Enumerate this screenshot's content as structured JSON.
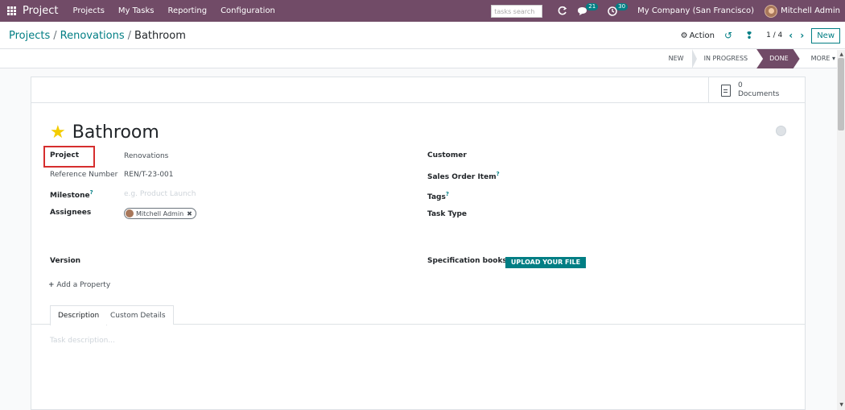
{
  "navbar": {
    "brand": "Project",
    "menu": [
      "Projects",
      "My Tasks",
      "Reporting",
      "Configuration"
    ],
    "search_placeholder": "tasks search",
    "messages_count": "21",
    "activities_count": "30",
    "company": "My Company (San Francisco)",
    "user": "Mitchell Admin"
  },
  "breadcrumb": {
    "items": [
      "Projects",
      "Renovations",
      "Bathroom"
    ],
    "separator": "/"
  },
  "control_panel": {
    "action_label": "Action",
    "pager": "1 / 4",
    "new_label": "New"
  },
  "stages": [
    "NEW",
    "IN PROGRESS",
    "DONE",
    "MORE"
  ],
  "current_stage": "DONE",
  "documents": {
    "count": "0",
    "label": "Documents"
  },
  "task": {
    "title": "Bathroom",
    "starred": true
  },
  "fields": {
    "project_label": "Project",
    "project_value": "Renovations",
    "reference_label": "Reference Number",
    "reference_value": "REN/T-23-001",
    "milestone_label": "Milestone",
    "milestone_placeholder": "e.g. Product Launch",
    "assignees_label": "Assignees",
    "assignee_name": "Mitchell Admin",
    "customer_label": "Customer",
    "sales_order_label": "Sales Order Item",
    "tags_label": "Tags",
    "task_type_label": "Task Type",
    "version_label": "Version",
    "spec_books_label": "Specification books",
    "upload_label": "UPLOAD YOUR FILE",
    "add_property_label": "Add a Property",
    "help_marker": "?"
  },
  "tabs": [
    "Description",
    "Custom Details"
  ],
  "description_placeholder": "Task description...",
  "colors": {
    "brand": "#714b67",
    "accent": "#017e84",
    "highlight": "#d62e2e",
    "star": "#f3cc00"
  }
}
